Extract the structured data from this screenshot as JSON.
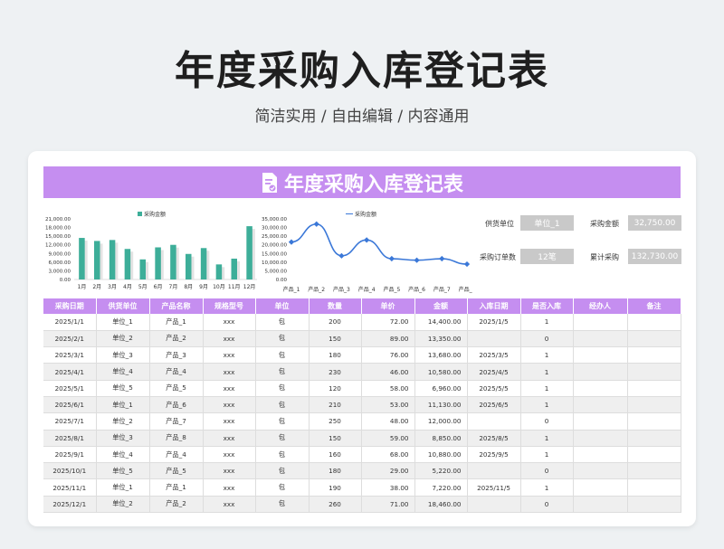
{
  "header": {
    "title": "年度采购入库登记表",
    "subtitle": "简洁实用 / 自由编辑 / 内容通用"
  },
  "sheet": {
    "banner_title": "年度采购入库登记表",
    "accent_color": "#c58ef0"
  },
  "chart_data": [
    {
      "type": "bar",
      "legend": "采购金额",
      "color": "#3dae99",
      "categories": [
        "1月",
        "2月",
        "3月",
        "4月",
        "5月",
        "6月",
        "7月",
        "8月",
        "9月",
        "10月",
        "11月",
        "12月"
      ],
      "values": [
        14400,
        13350,
        13680,
        10580,
        6960,
        11130,
        12000,
        8850,
        10880,
        5220,
        7220,
        18460
      ],
      "ylim": [
        0,
        21000
      ],
      "yticks": [
        "21,000.00",
        "18,000.00",
        "15,000.00",
        "12,000.00",
        "9,000.00",
        "6,000.00",
        "3,000.00",
        "0.00"
      ]
    },
    {
      "type": "line",
      "legend": "采购金额",
      "color": "#3b78d8",
      "categories": [
        "产品_1",
        "产品_2",
        "产品_3",
        "产品_4",
        "产品_5",
        "产品_6",
        "产品_7",
        "产品_8"
      ],
      "values": [
        21600,
        32000,
        13680,
        22800,
        12000,
        11130,
        12000,
        8850
      ],
      "ylim": [
        0,
        35000
      ],
      "yticks": [
        "35,000.00",
        "30,000.00",
        "25,000.00",
        "20,000.00",
        "15,000.00",
        "10,000.00",
        "5,000.00",
        "0.00"
      ]
    }
  ],
  "kpis": {
    "supplier_label": "供货单位",
    "supplier_value": "单位_1",
    "amount_label": "采购金额",
    "amount_value": "32,750.00",
    "orders_label": "采购订单数",
    "orders_value": "12笔",
    "cumulative_label": "累计采购",
    "cumulative_value": "132,730.00"
  },
  "table": {
    "columns": [
      "采购日期",
      "供货单位",
      "产品名称",
      "规格型号",
      "单位",
      "数量",
      "单价",
      "金额",
      "入库日期",
      "是否入库",
      "经办人",
      "备注"
    ],
    "rows": [
      [
        "2025/1/1",
        "单位_1",
        "产品_1",
        "xxx",
        "包",
        "200",
        "72.00",
        "14,400.00",
        "2025/1/5",
        "1",
        "",
        ""
      ],
      [
        "2025/2/1",
        "单位_2",
        "产品_2",
        "xxx",
        "包",
        "150",
        "89.00",
        "13,350.00",
        "",
        "0",
        "",
        ""
      ],
      [
        "2025/3/1",
        "单位_3",
        "产品_3",
        "xxx",
        "包",
        "180",
        "76.00",
        "13,680.00",
        "2025/3/5",
        "1",
        "",
        ""
      ],
      [
        "2025/4/1",
        "单位_4",
        "产品_4",
        "xxx",
        "包",
        "230",
        "46.00",
        "10,580.00",
        "2025/4/5",
        "1",
        "",
        ""
      ],
      [
        "2025/5/1",
        "单位_5",
        "产品_5",
        "xxx",
        "包",
        "120",
        "58.00",
        "6,960.00",
        "2025/5/5",
        "1",
        "",
        ""
      ],
      [
        "2025/6/1",
        "单位_1",
        "产品_6",
        "xxx",
        "包",
        "210",
        "53.00",
        "11,130.00",
        "2025/6/5",
        "1",
        "",
        ""
      ],
      [
        "2025/7/1",
        "单位_2",
        "产品_7",
        "xxx",
        "包",
        "250",
        "48.00",
        "12,000.00",
        "",
        "0",
        "",
        ""
      ],
      [
        "2025/8/1",
        "单位_3",
        "产品_8",
        "xxx",
        "包",
        "150",
        "59.00",
        "8,850.00",
        "2025/8/5",
        "1",
        "",
        ""
      ],
      [
        "2025/9/1",
        "单位_4",
        "产品_4",
        "xxx",
        "包",
        "160",
        "68.00",
        "10,880.00",
        "2025/9/5",
        "1",
        "",
        ""
      ],
      [
        "2025/10/1",
        "单位_5",
        "产品_5",
        "xxx",
        "包",
        "180",
        "29.00",
        "5,220.00",
        "",
        "0",
        "",
        ""
      ],
      [
        "2025/11/1",
        "单位_1",
        "产品_1",
        "xxx",
        "包",
        "190",
        "38.00",
        "7,220.00",
        "2025/11/5",
        "1",
        "",
        ""
      ],
      [
        "2025/12/1",
        "单位_2",
        "产品_2",
        "xxx",
        "包",
        "260",
        "71.00",
        "18,460.00",
        "",
        "0",
        "",
        ""
      ]
    ]
  }
}
